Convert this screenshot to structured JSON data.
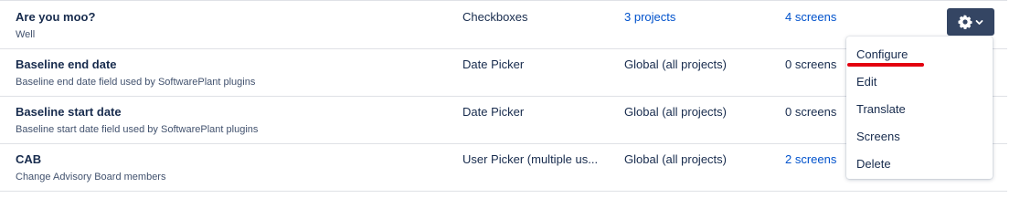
{
  "rows": [
    {
      "name": "Are you moo?",
      "description": "Well",
      "type": "Checkboxes",
      "context": "3 projects",
      "screens": "4 screens"
    },
    {
      "name": "Baseline end date",
      "description": "Baseline end date field used by SoftwarePlant plugins",
      "type": "Date Picker",
      "context": "Global (all projects)",
      "screens": "0 screens"
    },
    {
      "name": "Baseline start date",
      "description": "Baseline start date field used by SoftwarePlant plugins",
      "type": "Date Picker",
      "context": "Global (all projects)",
      "screens": "0 screens"
    },
    {
      "name": "CAB",
      "description": "Change Advisory Board members",
      "type": "User Picker (multiple us...",
      "context": "Global (all projects)",
      "screens": "2 screens"
    }
  ],
  "actions_menu": {
    "items": [
      "Configure",
      "Edit",
      "Translate",
      "Screens",
      "Delete"
    ]
  },
  "colors": {
    "link": "#0052cc",
    "button_bg": "#344563",
    "annotation_underline": "#e3000f"
  },
  "icons": {
    "actions_button": [
      "gear-icon",
      "chevron-down-icon"
    ]
  }
}
